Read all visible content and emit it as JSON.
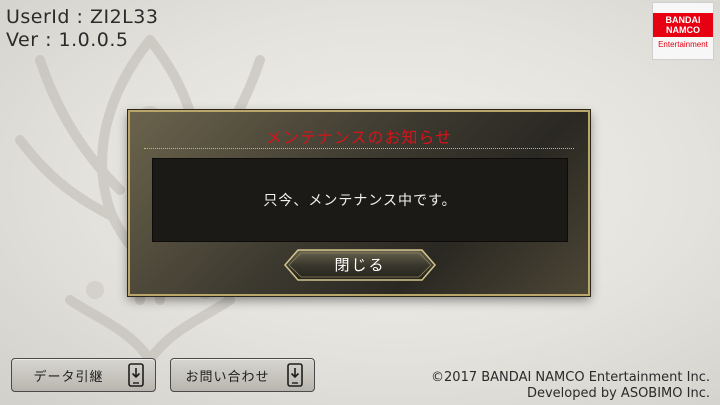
{
  "info": {
    "user_id": "UserId : ZI2L33",
    "version": "Ver : 1.0.0.5"
  },
  "logo": {
    "brand": "BANDAI NAMCO",
    "sub": "Entertainment"
  },
  "dialog": {
    "title": "メンテナンスのお知らせ",
    "message": "只今、メンテナンス中です。",
    "close_label": "閉じる"
  },
  "footer": {
    "data_transfer_label": "データ引継",
    "contact_label": "お問い合わせ",
    "copyright_line1": "©2017 BANDAI NAMCO Entertainment Inc.",
    "copyright_line2": "Developed by ASOBIMO Inc."
  },
  "colors": {
    "title_red": "#d8131a",
    "brand_red": "#e60012",
    "dialog_border": "#bba66a"
  }
}
